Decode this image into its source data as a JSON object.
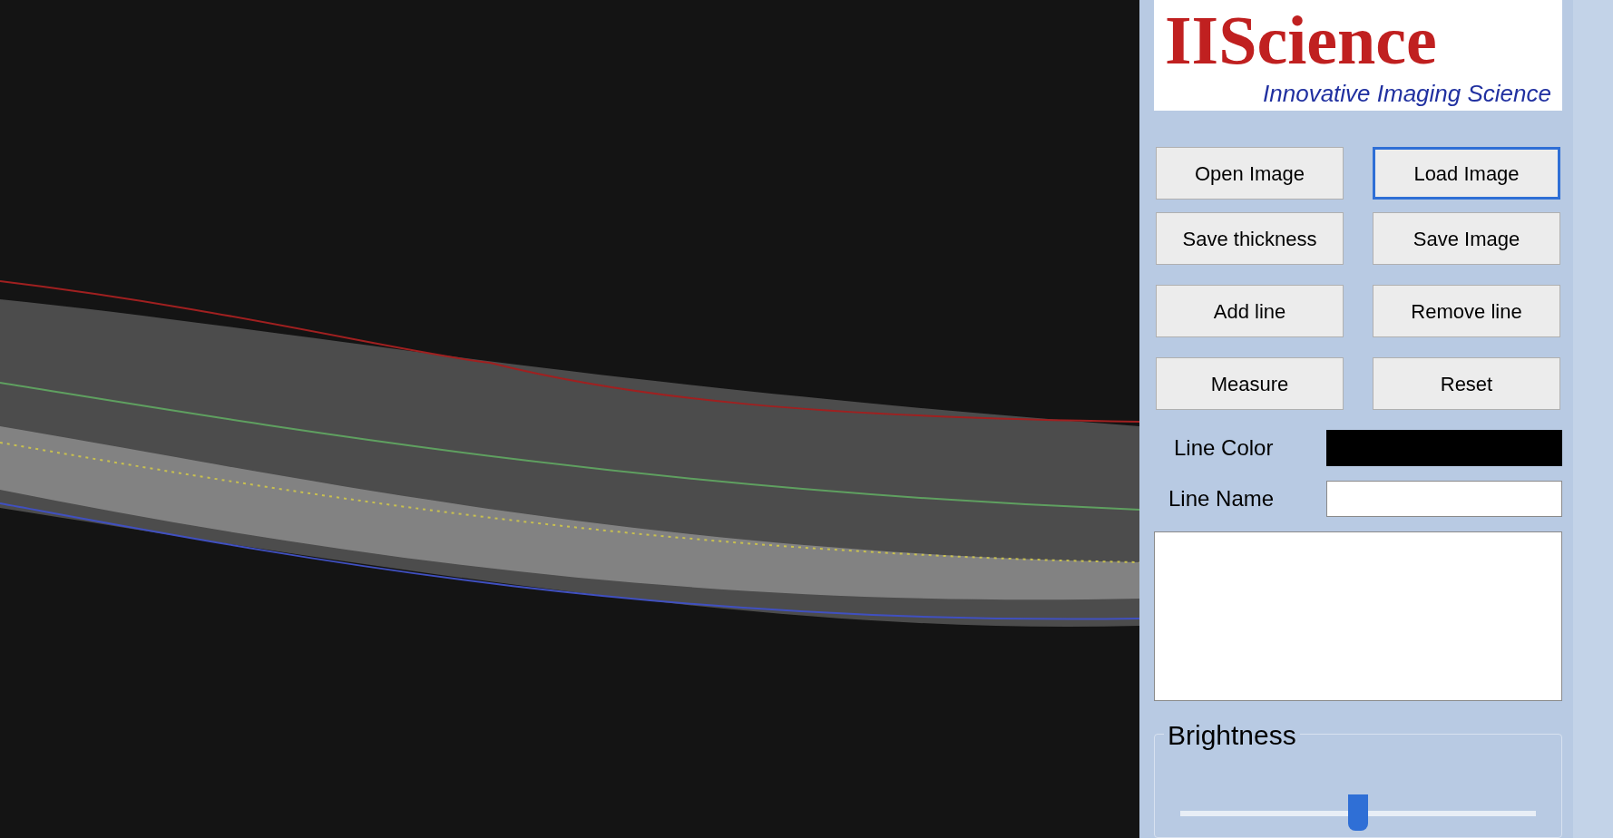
{
  "logo": {
    "title": "IIScience",
    "tagline": "Innovative Imaging Science"
  },
  "buttons": [
    {
      "label": "Open Image",
      "focused": false
    },
    {
      "label": "Load Image",
      "focused": true
    },
    {
      "label": "Save thickness",
      "focused": false
    },
    {
      "label": "Save Image",
      "focused": false
    },
    {
      "label": "Add line",
      "focused": false
    },
    {
      "label": "Remove line",
      "focused": false
    },
    {
      "label": "Measure",
      "focused": false
    },
    {
      "label": "Reset",
      "focused": false
    }
  ],
  "line_color": {
    "label": "Line Color",
    "color": "#000000"
  },
  "line_name": {
    "label": "Line Name"
  },
  "brightness": {
    "title": "Brightness",
    "level": 0.5
  }
}
